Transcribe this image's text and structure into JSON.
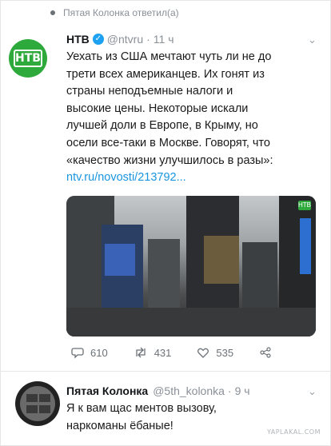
{
  "retweet_context": {
    "text": "Пятая Колонка ответил(а)"
  },
  "tweet": {
    "author_name": "НТВ",
    "handle": "@ntvru",
    "separator": "·",
    "time": "11 ч",
    "text_lines": [
      "Уехать из США мечтают чуть ли не до",
      "трети всех американцев. Их гонят из",
      "страны неподъемные налоги и",
      "высокие цены. Некоторые искали",
      "лучшей доли в Европе, в Крыму, но",
      "осели все-таки в Москве. Говорят, что",
      "«качество жизни улучшилось в разы»:"
    ],
    "link": "ntv.ru/novosti/213792...",
    "avatar_logo": "НТВ",
    "media_badge": "НТВ",
    "stats": {
      "replies": "610",
      "retweets": "431",
      "likes": "535"
    }
  },
  "reply": {
    "author_name": "Пятая Колонка",
    "handle": "@5th_kolonka",
    "separator": "·",
    "time": "9 ч",
    "text_lines": [
      "Я к вам щас ментов вызову,",
      "наркоманы ёбаные!"
    ]
  },
  "watermark": "YAPLAKAL.COM",
  "icons": [
    "retweet-dot-icon",
    "verified-icon",
    "chevron-down-icon",
    "reply-icon",
    "retweet-icon",
    "like-icon",
    "share-icon"
  ],
  "colors": {
    "accent": "#1da1f2",
    "link": "#1b95e0",
    "ntv_green": "#2eaa3c",
    "muted": "#8a9097"
  }
}
